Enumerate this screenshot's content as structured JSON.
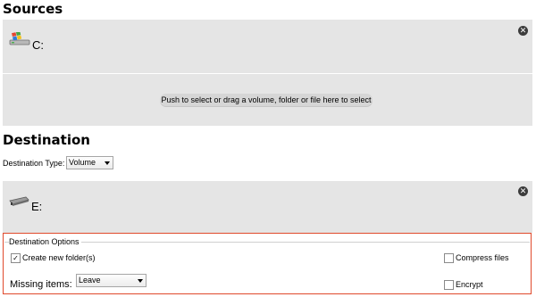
{
  "sources": {
    "title": "Sources",
    "drive_label": "C:",
    "push_button_label": "Push to select or drag a volume, folder or file here to select"
  },
  "destination": {
    "title": "Destination",
    "type_label": "Destination Type:",
    "type_value": "Volume",
    "drive_label": "E:"
  },
  "options": {
    "legend": "Destination Options",
    "create_folder_label": "Create new folder(s)",
    "create_folder_checked": true,
    "compress_label": "Compress files",
    "compress_checked": false,
    "encrypt_label": "Encrypt",
    "encrypt_checked": false,
    "missing_items_label": "Missing items:",
    "missing_items_value": "Leave"
  },
  "colors": {
    "panel_bg": "#e5e5e5",
    "highlight_border": "#e04a2c"
  }
}
